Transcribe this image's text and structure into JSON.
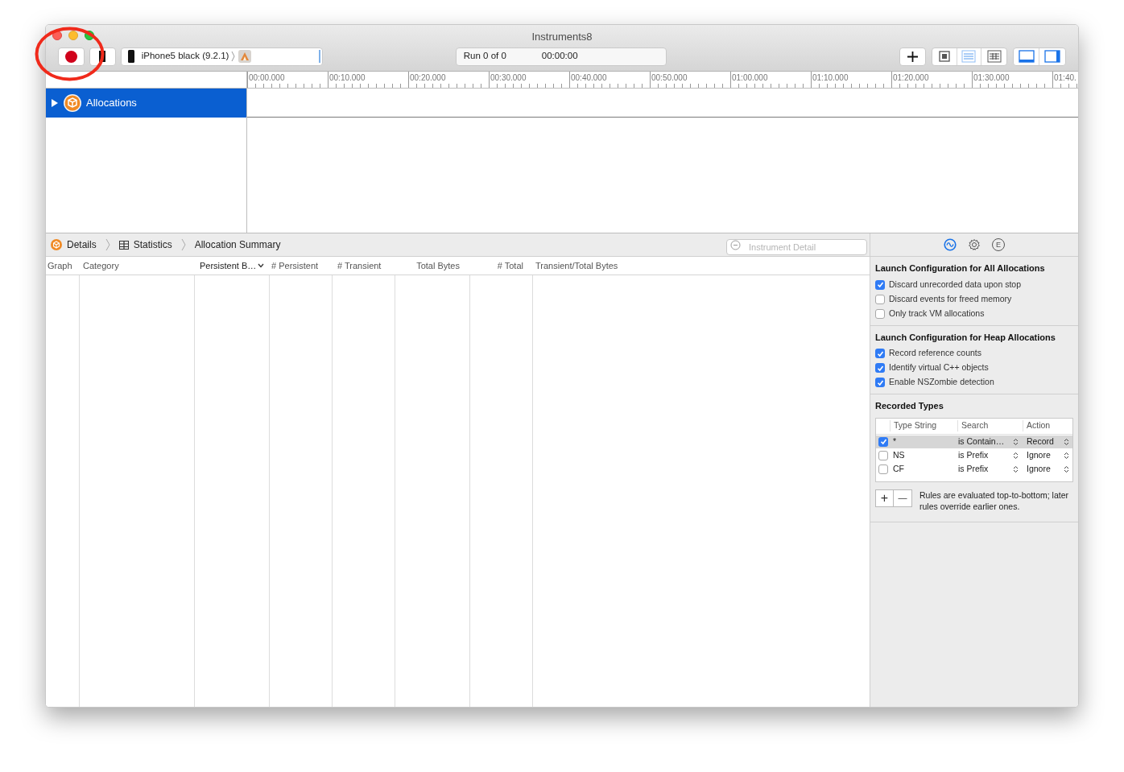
{
  "window": {
    "title": "Instruments8"
  },
  "toolbar": {
    "recording": false,
    "target": "iPhone5 black (9.2.1)",
    "run": "Run 0 of 0",
    "time": "00:00:00",
    "view_buttons": [
      {
        "kind": "cpu",
        "selected": false
      },
      {
        "kind": "list",
        "selected": true
      },
      {
        "kind": "grid",
        "selected": false
      }
    ],
    "panel_buttons": [
      {
        "kind": "bottom",
        "selected": true
      },
      {
        "kind": "right",
        "selected": true
      }
    ]
  },
  "timeline": {
    "ticks": [
      "00:00.000",
      "00:10.000",
      "00:20.000",
      "00:30.000",
      "00:40.000",
      "00:50.000",
      "01:00.000",
      "01:10.000",
      "01:20.000",
      "01:30.000",
      "01:40."
    ]
  },
  "tracks": [
    {
      "name": "Allocations",
      "selected": true,
      "expanded": false
    }
  ],
  "breadcrumb": [
    {
      "kind": "instrument",
      "label": "Details"
    },
    {
      "kind": "grid",
      "label": "Statistics"
    },
    {
      "kind": "none",
      "label": "Allocation Summary"
    }
  ],
  "detail_search": {
    "placeholder": "Instrument Detail"
  },
  "columns": [
    {
      "label": "Graph",
      "sorted": false
    },
    {
      "label": "Category",
      "sorted": false
    },
    {
      "label": "Persistent B…",
      "sorted": true
    },
    {
      "label": "# Persistent",
      "sorted": false
    },
    {
      "label": "# Transient",
      "sorted": false
    },
    {
      "label": "Total Bytes",
      "sorted": false
    },
    {
      "label": "# Total",
      "sorted": false
    },
    {
      "label": "Transient/Total Bytes",
      "sorted": false
    }
  ],
  "inspector": {
    "tabs": [
      {
        "kind": "wave",
        "selected": true
      },
      {
        "kind": "gear",
        "selected": false
      },
      {
        "kind": "letter",
        "glyph": "E",
        "selected": false
      }
    ],
    "sections": [
      {
        "title": "Launch Configuration for All Allocations",
        "options": [
          {
            "label": "Discard unrecorded data upon stop",
            "checked": true
          },
          {
            "label": "Discard events for freed memory",
            "checked": false
          },
          {
            "label": "Only track VM allocations",
            "checked": false
          }
        ]
      },
      {
        "title": "Launch Configuration for Heap Allocations",
        "options": [
          {
            "label": "Record reference counts",
            "checked": true
          },
          {
            "label": "Identify virtual C++ objects",
            "checked": true
          },
          {
            "label": "Enable NSZombie detection",
            "checked": true
          }
        ]
      }
    ],
    "recorded_types": {
      "title": "Recorded Types",
      "columns": [
        "Type String",
        "Search",
        "Action"
      ],
      "rows": [
        {
          "type": "*",
          "search": "is Contain…",
          "action": "Record",
          "checked": true,
          "selected": true
        },
        {
          "type": "NS",
          "search": "is Prefix",
          "action": "Ignore",
          "checked": false,
          "selected": false
        },
        {
          "type": "CF",
          "search": "is Prefix",
          "action": "Ignore",
          "checked": false,
          "selected": false
        }
      ],
      "add_button": "+",
      "remove_button": "—",
      "note": "Rules are evaluated top-to-bottom; later rules override earlier ones."
    }
  }
}
